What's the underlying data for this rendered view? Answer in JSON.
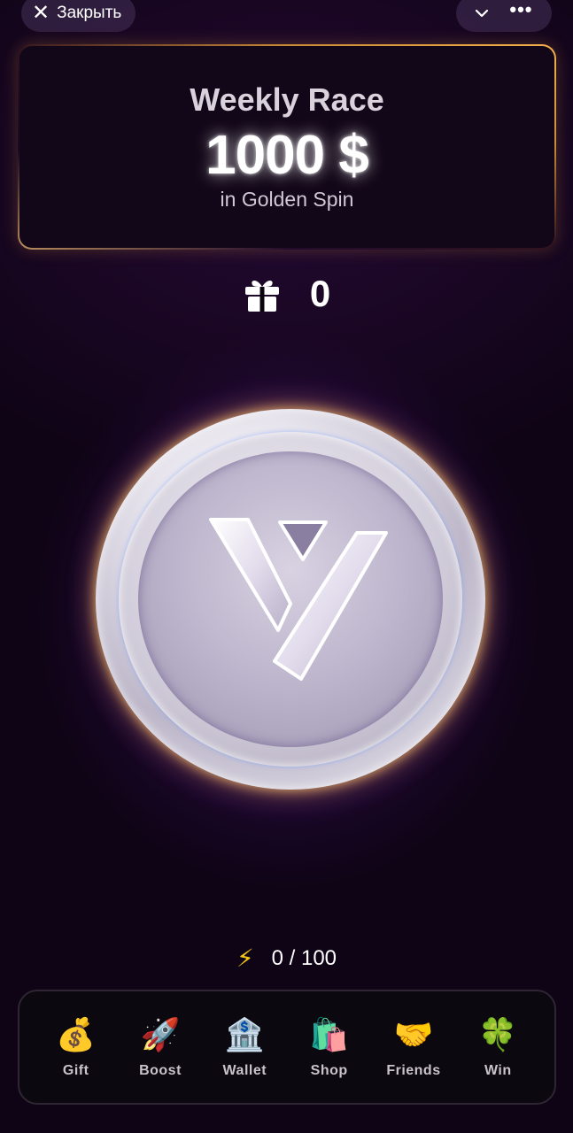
{
  "topbar": {
    "close_label": "Закрыть",
    "close_icon": "close-icon",
    "chevron_icon": "chevron-down-icon",
    "more_icon": "more-icon"
  },
  "race": {
    "title": "Weekly Race",
    "amount": "1000 $",
    "subtitle": "in Golden Spin"
  },
  "gifts": {
    "icon": "gift-icon",
    "count": "0"
  },
  "coin": {
    "icon": "coin-logo-icon"
  },
  "energy": {
    "icon": "lightning-icon",
    "text": "0 / 100"
  },
  "nav": {
    "items": [
      {
        "label": "Gift",
        "emoji": "💰"
      },
      {
        "label": "Boost",
        "emoji": "🚀"
      },
      {
        "label": "Wallet",
        "emoji": "🏦"
      },
      {
        "label": "Shop",
        "emoji": "🛍️"
      },
      {
        "label": "Friends",
        "emoji": "🤝"
      },
      {
        "label": "Win",
        "emoji": "🍀"
      }
    ]
  },
  "colors": {
    "background": "#08030d",
    "accent_gold": "#f3b04a",
    "glow_purple": "#7828be"
  }
}
